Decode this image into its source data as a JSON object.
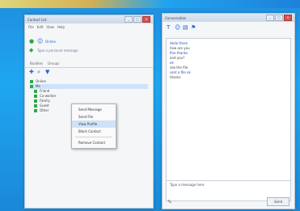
{
  "left_window": {
    "title": "Contact List",
    "menu": [
      "File",
      "Edit",
      "View",
      "Help"
    ],
    "toolbar_label": "Online",
    "status_line": "Type a personal message",
    "tabs": [
      "Buddies",
      "Groups"
    ],
    "tree": [
      {
        "label": "Online",
        "selected": false
      },
      {
        "label": "Me",
        "selected": true
      },
      {
        "label": "Friend",
        "selected": false
      },
      {
        "label": "Co-worker",
        "selected": false
      },
      {
        "label": "Family",
        "selected": false
      },
      {
        "label": "Guest",
        "selected": false
      },
      {
        "label": "Other",
        "selected": false
      }
    ]
  },
  "context_menu": {
    "items": [
      "Send Message",
      "Send File",
      "View Profile",
      "Block Contact",
      "Remove Contact"
    ],
    "hover_index": 2
  },
  "right_window": {
    "title": "Conversation",
    "toolbar_icons": [
      "text-icon",
      "emoticon-icon",
      "file-icon",
      "flag-icon"
    ],
    "messages": [
      "Hello there",
      "how are you",
      "fine thanks",
      "and you?",
      "ok",
      "see the file",
      "sent a file ok",
      "thanks"
    ],
    "input_text": "Type a message here",
    "send_label": "Send"
  }
}
